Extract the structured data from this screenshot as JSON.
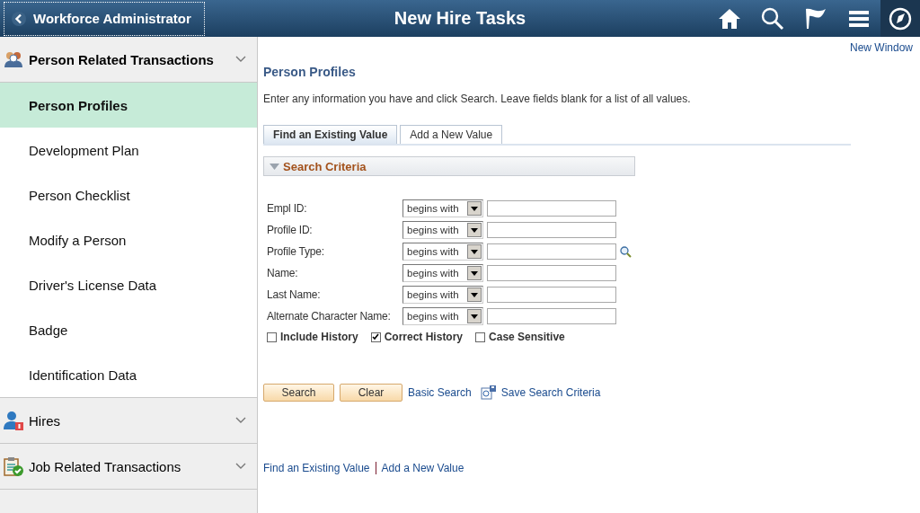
{
  "header": {
    "back_label": "Workforce Administrator",
    "title": "New Hire Tasks"
  },
  "sidebar": {
    "groups": [
      {
        "label": "Person Related Transactions",
        "kind": "people",
        "expanded": true,
        "items": [
          {
            "label": "Person Profiles",
            "selected": true
          },
          {
            "label": "Development Plan",
            "selected": false
          },
          {
            "label": "Person Checklist",
            "selected": false
          },
          {
            "label": "Modify a Person",
            "selected": false
          },
          {
            "label": "Driver's License Data",
            "selected": false
          },
          {
            "label": "Badge",
            "selected": false
          },
          {
            "label": "Identification Data",
            "selected": false
          }
        ]
      },
      {
        "label": "Hires",
        "kind": "person",
        "expanded": false
      },
      {
        "label": "Job Related Transactions",
        "kind": "clipboard",
        "expanded": false
      }
    ]
  },
  "main": {
    "new_window": "New Window",
    "title": "Person Profiles",
    "instructions": "Enter any information you have and click Search. Leave fields blank for a list of all values.",
    "tabs": [
      {
        "label": "Find an Existing Value",
        "selected": true
      },
      {
        "label": "Add a New Value",
        "selected": false
      }
    ],
    "section_title": "Search Criteria",
    "fields": [
      {
        "label": "Empl ID:",
        "operator": "begins with",
        "lookup": false
      },
      {
        "label": "Profile ID:",
        "operator": "begins with",
        "lookup": false
      },
      {
        "label": "Profile Type:",
        "operator": "begins with",
        "lookup": true
      },
      {
        "label": "Name:",
        "operator": "begins with",
        "lookup": false
      },
      {
        "label": "Last Name:",
        "operator": "begins with",
        "lookup": false
      },
      {
        "label": "Alternate Character Name:",
        "operator": "begins with",
        "lookup": false
      }
    ],
    "options": [
      {
        "label": "Include History",
        "checked": false
      },
      {
        "label": "Correct History",
        "checked": true
      },
      {
        "label": "Case Sensitive",
        "checked": false
      }
    ],
    "buttons": [
      "Search",
      "Clear"
    ],
    "basic_search": "Basic Search",
    "save_criteria": "Save Search Criteria",
    "bottom_links": [
      "Find an Existing Value",
      "Add a New Value"
    ]
  }
}
